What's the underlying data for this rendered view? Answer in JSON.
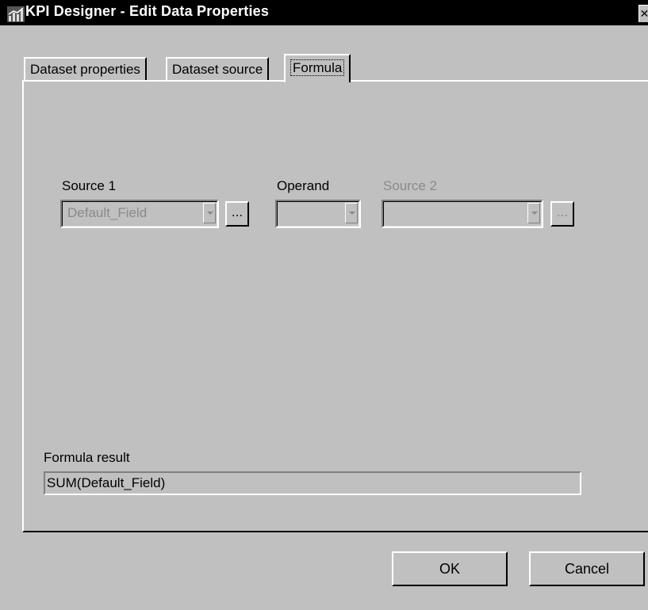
{
  "window": {
    "title": "KPI Designer - Edit Data Properties",
    "icon": "chart-icon",
    "close_label": "✕"
  },
  "tabs": [
    {
      "label": "Dataset properties",
      "active": false
    },
    {
      "label": "Dataset source",
      "active": false
    },
    {
      "label": "Formula",
      "active": true
    }
  ],
  "formula": {
    "source1_label": "Source 1",
    "source1_value": "Default_Field",
    "operand_label": "Operand",
    "operand_value": "",
    "source2_label": "Source 2",
    "source2_value": "",
    "browse_label": "...",
    "result_label": "Formula result",
    "result_value": "SUM(Default_Field)"
  },
  "buttons": {
    "ok": "OK",
    "cancel": "Cancel"
  }
}
